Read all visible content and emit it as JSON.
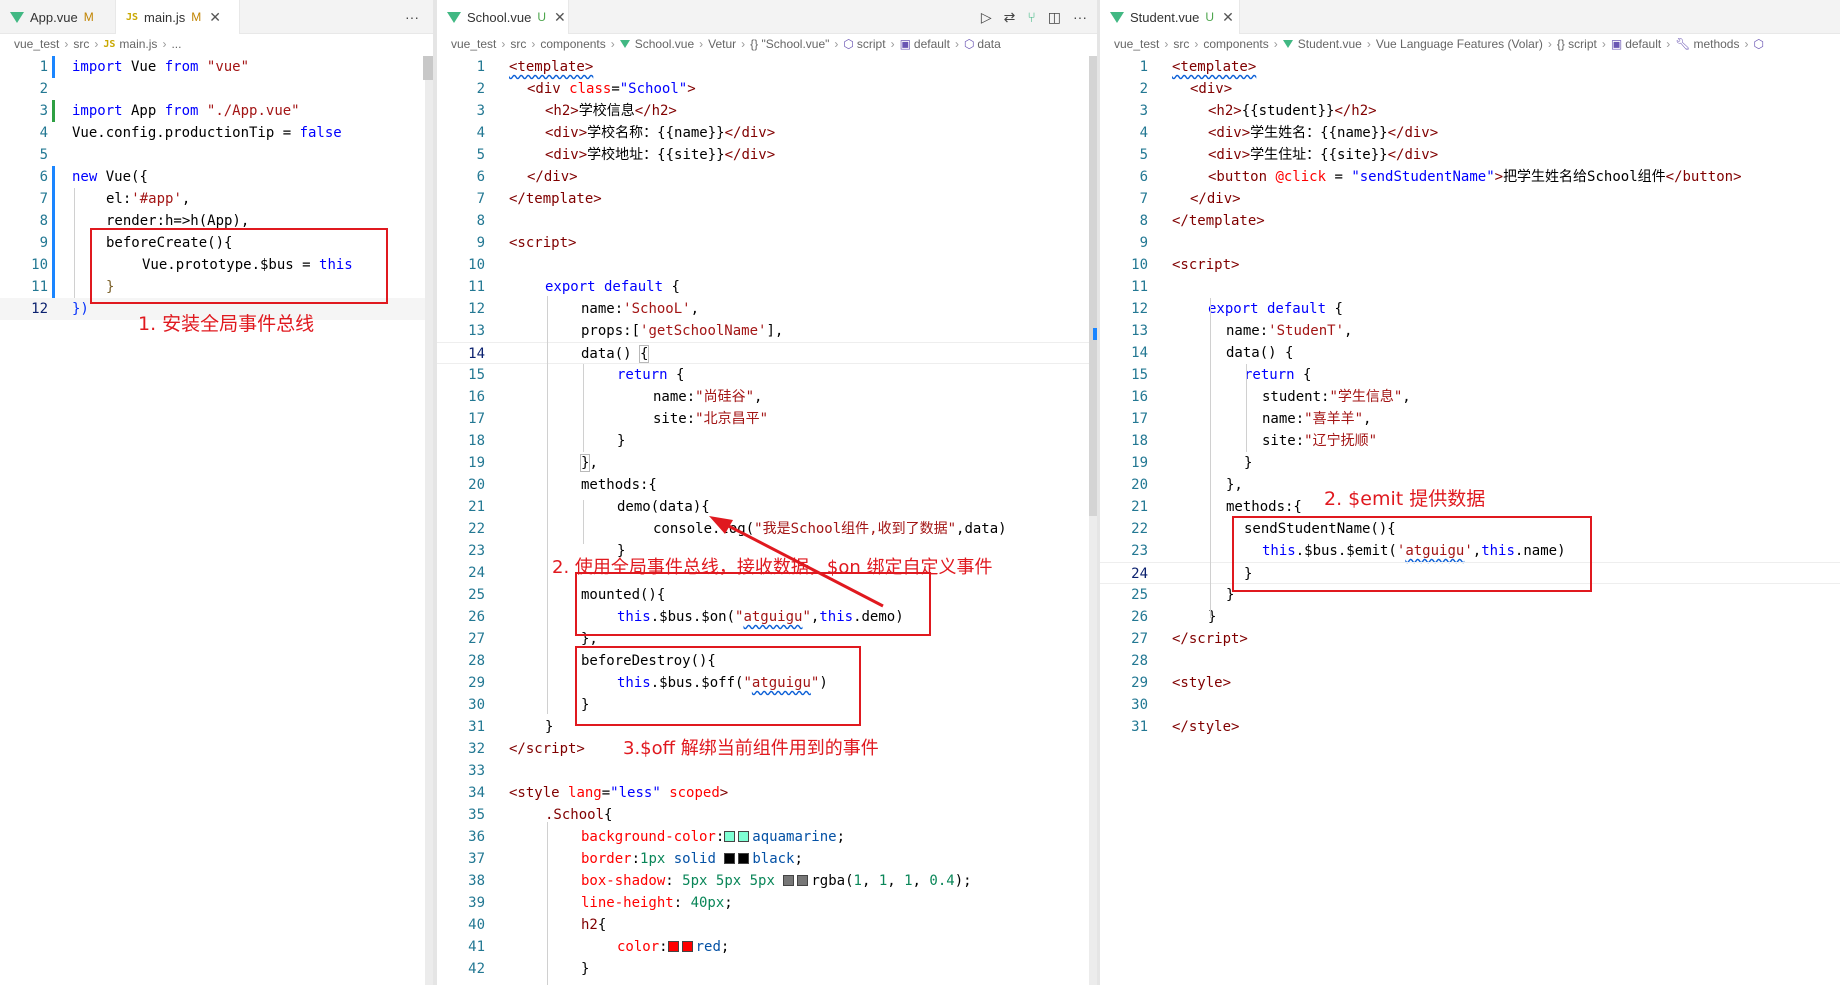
{
  "colors": {
    "accent": "#e0191f",
    "vue": "#41b883",
    "modified": "#c18401",
    "untracked": "#4ea64e"
  },
  "left": {
    "tabs": [
      {
        "icon": "vue-icon",
        "name": "App.vue",
        "state": "M"
      },
      {
        "icon": "js-icon",
        "name": "main.js",
        "state": "M"
      }
    ],
    "more": "···",
    "breadcrumb": [
      "vue_test",
      "src",
      "main.js",
      "..."
    ],
    "annotation": "1. 安装全局事件总线"
  },
  "middle": {
    "tab": {
      "name": "School.vue",
      "state": "U"
    },
    "more": "···",
    "breadcrumb": [
      "vue_test",
      "src",
      "components",
      "School.vue",
      "Vetur",
      "{} \"School.vue\"",
      "script",
      "default",
      "data"
    ],
    "annotation_on": "2. 使用全局事件总线，接收数据，$on 绑定自定义事件",
    "annotation_off": "3.$off 解绑当前组件用到的事件"
  },
  "right": {
    "tab": {
      "name": "Student.vue",
      "state": "U"
    },
    "breadcrumb": [
      "vue_test",
      "src",
      "components",
      "Student.vue",
      "Vue Language Features (Volar)",
      "{} script",
      "default",
      "methods"
    ],
    "annotation": "2. $emit 提供数据"
  }
}
